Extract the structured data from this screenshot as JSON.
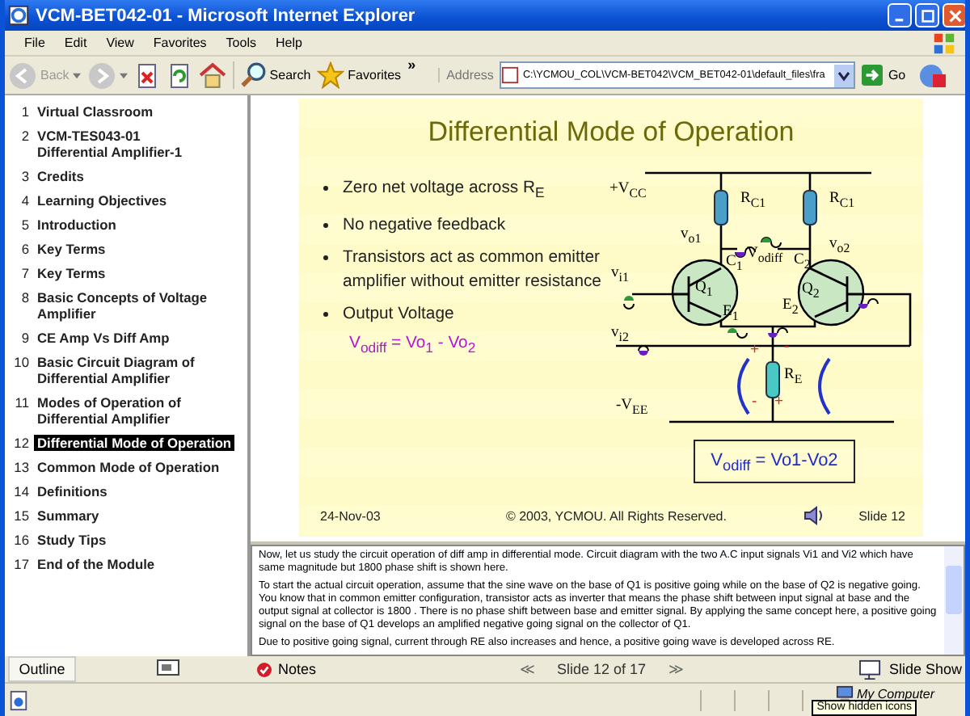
{
  "window": {
    "title": "VCM-BET042-01 - Microsoft Internet Explorer"
  },
  "menu": [
    "File",
    "Edit",
    "View",
    "Favorites",
    "Tools",
    "Help"
  ],
  "toolbar": [
    {
      "kind": "back",
      "label": "Back",
      "disabled": true
    },
    {
      "kind": "forward",
      "disabled": true
    },
    {
      "kind": "stop"
    },
    {
      "kind": "refresh"
    },
    {
      "kind": "home"
    },
    {
      "kind": "search",
      "label": "Search"
    },
    {
      "kind": "favorites",
      "label": "Favorites"
    },
    {
      "kind": "more",
      "label": "»"
    }
  ],
  "address": {
    "label": "Address",
    "value": "C:\\YCMOU_COL\\VCM-BET042\\VCM_BET042-01\\default_files\\fra",
    "go": "Go"
  },
  "outline": {
    "items": [
      {
        "number": "1",
        "title": "Virtual Classroom",
        "selected": false
      },
      {
        "number": "2",
        "title": "VCM-TES043-01\nDifferential Amplifier-1",
        "selected": false
      },
      {
        "number": "3",
        "title": "Credits",
        "selected": false
      },
      {
        "number": "4",
        "title": "Learning Objectives",
        "selected": false
      },
      {
        "number": "5",
        "title": "Introduction",
        "selected": false
      },
      {
        "number": "6",
        "title": "Key Terms",
        "selected": false
      },
      {
        "number": "7",
        "title": "Key Terms",
        "selected": false
      },
      {
        "number": "8",
        "title": "Basic Concepts of Voltage\nAmplifier",
        "selected": false
      },
      {
        "number": "9",
        "title": "CE Amp Vs Diff Amp",
        "selected": false
      },
      {
        "number": "10",
        "title": "Basic Circuit Diagram of\nDifferential Amplifier",
        "selected": false
      },
      {
        "number": "11",
        "title": "Modes of Operation of\nDifferential Amplifier",
        "selected": false
      },
      {
        "number": "12",
        "title": "Differential Mode of Operation",
        "selected": true
      },
      {
        "number": "13",
        "title": "Common Mode of Operation",
        "selected": false
      },
      {
        "number": "14",
        "title": "Definitions",
        "selected": false
      },
      {
        "number": "15",
        "title": "Summary",
        "selected": false
      },
      {
        "number": "16",
        "title": "Study Tips",
        "selected": false
      },
      {
        "number": "17",
        "title": "End of the Module",
        "selected": false
      }
    ]
  },
  "slide": {
    "title": "Differential Mode of Operation",
    "bullets": [
      "Zero net voltage across R$_{E}$",
      "No negative feedback",
      "Transistors act as common emitter amplifier without emitter resistance",
      "Output Voltage"
    ],
    "output_formula": "V$_{odiff}$ = Vo$_{1}$ - Vo$_{2}$",
    "diagram_labels": [
      {
        "kind": "label",
        "text": "+V$_{CC}$"
      },
      {
        "kind": "label",
        "text": "R$_{C1}$"
      },
      {
        "kind": "label",
        "text": "R$_{C1}$"
      },
      {
        "kind": "label",
        "text": "v$_{o1}$"
      },
      {
        "kind": "label",
        "text": "V$_{odiff}$"
      },
      {
        "kind": "label",
        "text": "C$_{1}$"
      },
      {
        "kind": "label",
        "text": "C$_{2}$"
      },
      {
        "kind": "label",
        "text": "v$_{o2}$"
      },
      {
        "kind": "label",
        "text": "v$_{i1}$"
      },
      {
        "kind": "label",
        "text": "Q$_{1}$"
      },
      {
        "kind": "label",
        "text": "Q$_{2}$"
      },
      {
        "kind": "label",
        "text": "E$_{1}$"
      },
      {
        "kind": "label",
        "text": "E$_{2}$"
      },
      {
        "kind": "label",
        "text": "v$_{i2}$"
      },
      {
        "kind": "label",
        "text": "R$_{E}$"
      },
      {
        "kind": "label",
        "text": "-V$_{EE}$"
      },
      {
        "kind": "sign",
        "text": "+"
      },
      {
        "kind": "sign",
        "text": "-"
      },
      {
        "kind": "sign",
        "text": "-"
      },
      {
        "kind": "sign",
        "text": "+"
      }
    ],
    "result_box": "V$_{odiff}$ = Vo1-Vo2",
    "footer": {
      "date": "24-Nov-03",
      "copyright": "© 2003, YCMOU. All Rights Reserved.",
      "number": "Slide 12"
    }
  },
  "notes": [
    "Now, let us study the circuit operation of diff amp in differential mode.  Circuit diagram with the two A.C input signals Vi1 and Vi2 which have same magnitude but 1800 phase shift is shown here.",
    "To start the actual circuit operation, assume that the sine wave on the base of Q1 is positive going while on the base of Q2 is negative going. You know that in common emitter configuration, transistor acts as inverter that means the phase shift between input signal at base and the output signal at collector is 1800 . There is no phase shift between base and emitter signal. By applying the same concept here, a positive going signal on the base of Q1 develops an amplified negative going signal on the collector of Q1.",
    "Due to positive going signal, current through RE also increases and hence, a positive going wave is developed across RE."
  ],
  "bottom_bar": {
    "tabs": [
      {
        "kind": "outline",
        "label": "Outline",
        "selected": true
      },
      {
        "kind": "slides",
        "selected": false
      }
    ],
    "notes": "Notes",
    "prev": "≪",
    "counter": "Slide 12 of 17",
    "next": "≫",
    "slide_show": "Slide Show"
  },
  "status_bar": {
    "zone": "My Computer",
    "tooltip": "Show hidden icons"
  }
}
